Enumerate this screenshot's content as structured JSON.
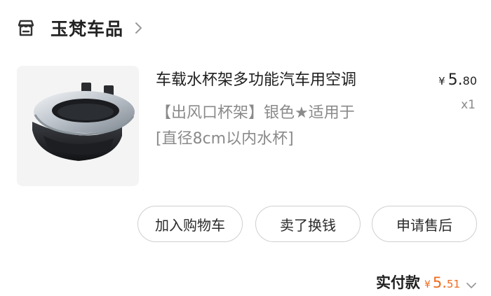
{
  "store": {
    "name": "玉梵车品",
    "icon": "store-icon",
    "arrow_icon": "chevron-right-icon"
  },
  "product": {
    "title": "车载水杯架多功能汽车用空调",
    "spec_line1": "【出风口杯架】银色★适用于",
    "spec_line2": "[直径8cm以内水杯]",
    "price_currency": "¥",
    "price_integer": "5.",
    "price_decimal": "80",
    "quantity": "x1"
  },
  "actions": {
    "add_to_cart": "加入购物车",
    "resell": "卖了换钱",
    "after_sale": "申请售后"
  },
  "payment": {
    "label": "实付款",
    "currency": "¥",
    "integer": "5.",
    "decimal": "51"
  },
  "colors": {
    "accent": "#f06a1b",
    "text": "#1f1f1f",
    "secondary_text": "#8a8a8a",
    "button_border": "#cfcfcf"
  }
}
